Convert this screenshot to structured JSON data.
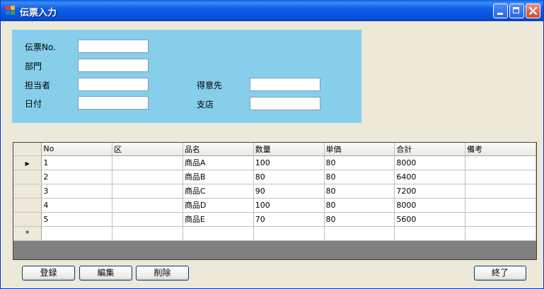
{
  "window": {
    "title": "伝票入力"
  },
  "header": {
    "fields": [
      {
        "label": "伝票No.",
        "value": ""
      },
      {
        "label": "部門",
        "value": ""
      },
      {
        "label": "担当者",
        "value": ""
      },
      {
        "label": "日付",
        "value": ""
      },
      {
        "label": "得意先",
        "value": ""
      },
      {
        "label": "支店",
        "value": ""
      }
    ]
  },
  "grid": {
    "columns": [
      "No",
      "区",
      "品名",
      "数量",
      "単価",
      "合計",
      "備考"
    ],
    "rows": [
      [
        "1",
        "",
        "商品A",
        "100",
        "80",
        "8000",
        ""
      ],
      [
        "2",
        "",
        "商品B",
        "80",
        "80",
        "6400",
        ""
      ],
      [
        "3",
        "",
        "商品C",
        "90",
        "80",
        "7200",
        ""
      ],
      [
        "4",
        "",
        "商品D",
        "100",
        "80",
        "8000",
        ""
      ],
      [
        "5",
        "",
        "商品E",
        "70",
        "80",
        "5600",
        ""
      ]
    ],
    "current_row_marker": "▶",
    "new_row_marker": "*"
  },
  "buttons": {
    "register": "登録",
    "edit": "編集",
    "delete": "削除",
    "exit": "終了"
  },
  "colors": {
    "header_panel": "#87ceeb",
    "window_bg": "#ece9d8",
    "titlebar": "#0450d8"
  }
}
